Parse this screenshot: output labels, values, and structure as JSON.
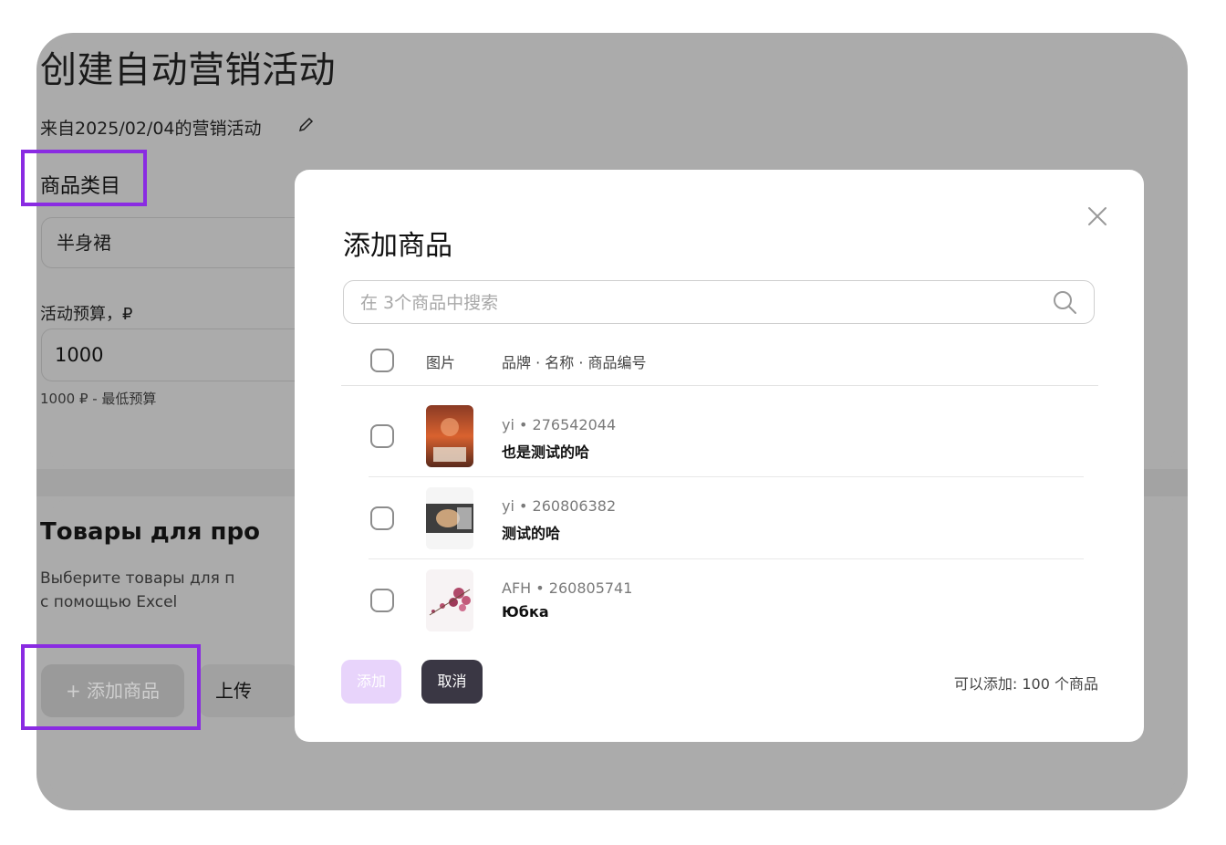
{
  "page": {
    "title": "创建自动营销活动",
    "subtitle": "来自2025/02/04的营销活动",
    "category": {
      "label": "商品类目",
      "value": "半身裙"
    },
    "budget": {
      "label": "活动预算，₽",
      "value": "1000",
      "hint": "1000 ₽ - 最低预算"
    },
    "goods": {
      "title": "Товары для про",
      "desc_line1": "Выберите товары для п",
      "desc_line2": "с помощью Excel",
      "add_button": "+ 添加商品",
      "upload_button": "上传"
    }
  },
  "modal": {
    "title": "添加商品",
    "search_placeholder": "在 3个商品中搜索",
    "columns": {
      "image": "图片",
      "info": "品牌 · 名称 · 商品编号"
    },
    "products": [
      {
        "brand": "yi",
        "sku": "276542044",
        "meta": "yi  •  276542044",
        "name": "也是测试的哈"
      },
      {
        "brand": "yi",
        "sku": "260806382",
        "meta": "yi  •  260806382",
        "name": "测试的哈"
      },
      {
        "brand": "AFH",
        "sku": "260805741",
        "meta": "AFH  •  260805741",
        "name": "Юбка"
      }
    ],
    "add_label": "添加",
    "cancel_label": "取消",
    "limit_text": "可以添加: 100 个商品"
  },
  "colors": {
    "accent": "#8a2be2",
    "overlay": "#ababab",
    "add_disabled": "#e8d4fb",
    "cancel_bg": "#3a3744"
  }
}
